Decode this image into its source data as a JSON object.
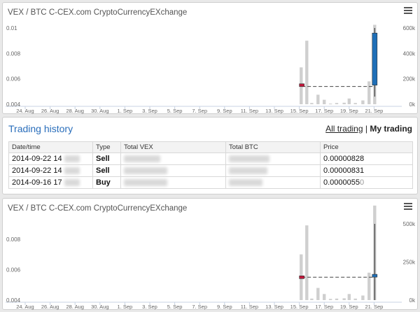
{
  "charts": [
    {
      "title": "VEX / BTC",
      "subtitle": "C-CEX.com CryptoCurrencyEXchange",
      "y_ticks": [
        "0.01",
        "0.008",
        "0.006",
        "0.004"
      ],
      "volume_ticks": [
        "600k",
        "400k",
        "200k",
        "0k"
      ]
    },
    {
      "title": "VEX / BTC",
      "subtitle": "C-CEX.com CryptoCurrencyEXchange",
      "y_ticks": [
        "0.008",
        "0.006",
        "0.004"
      ],
      "volume_ticks": [
        "500k",
        "250k",
        "0k"
      ]
    }
  ],
  "x_ticks": [
    "24. Aug",
    "26. Aug",
    "28. Aug",
    "30. Aug",
    "1. Sep",
    "3. Sep",
    "5. Sep",
    "7. Sep",
    "9. Sep",
    "11. Sep",
    "13. Sep",
    "15. Sep",
    "17. Sep",
    "19. Sep",
    "21. Sep"
  ],
  "history": {
    "title": "Trading history",
    "tab_all": "All trading",
    "tab_separator": "|",
    "tab_my": "My trading",
    "columns": [
      "Date/time",
      "Type",
      "Total VEX",
      "Total BTC",
      "Price"
    ],
    "rows": [
      {
        "datetime": "2014-09-22 14",
        "type": "Sell",
        "price": "0.00000828",
        "price_tail": ""
      },
      {
        "datetime": "2014-09-22 14",
        "type": "Sell",
        "price": "0.00000831",
        "price_tail": ""
      },
      {
        "datetime": "2014-09-16 17",
        "type": "Buy",
        "price": "0.0000055",
        "price_tail": "0"
      }
    ]
  },
  "chart_data": [
    {
      "type": "bar",
      "title": "VEX / BTC",
      "subtitle": "C-CEX.com CryptoCurrencyEXchange",
      "xlabel": "",
      "ylabel": "",
      "x_ticks": [
        "24. Aug",
        "26. Aug",
        "28. Aug",
        "30. Aug",
        "1. Sep",
        "3. Sep",
        "5. Sep",
        "7. Sep",
        "9. Sep",
        "11. Sep",
        "13. Sep",
        "15. Sep",
        "17. Sep",
        "19. Sep",
        "21. Sep"
      ],
      "x_range_days": [
        0,
        30
      ],
      "price_axis": [
        0.004,
        0.01
      ],
      "volume_axis": [
        0,
        600000
      ],
      "grid": false,
      "volume_series": {
        "name": "Volume",
        "x_days": [
          22.15,
          22.6,
          23.0,
          23.5,
          24.0,
          24.5,
          25.0,
          25.6,
          26.0,
          26.5,
          27.1,
          27.6,
          28.05
        ],
        "values": [
          290000,
          500000,
          10000,
          75000,
          35000,
          5000,
          10000,
          12000,
          45000,
          10000,
          30000,
          180000,
          625000
        ]
      },
      "candles": [
        {
          "x_day": 22.2,
          "open": 0.0055,
          "close": 0.0055,
          "high": 0.0055,
          "low": 0.0055,
          "color": "#c0163a"
        },
        {
          "x_day": 28.05,
          "open": 0.0055,
          "close": 0.0096,
          "high": 0.01,
          "low": 0.0046,
          "color": "#1f6fb7"
        }
      ],
      "last_price_line": 0.0054
    },
    {
      "type": "bar",
      "title": "VEX / BTC",
      "subtitle": "C-CEX.com CryptoCurrencyEXchange",
      "xlabel": "",
      "ylabel": "",
      "x_ticks": [
        "24. Aug",
        "26. Aug",
        "28. Aug",
        "30. Aug",
        "1. Sep",
        "3. Sep",
        "5. Sep",
        "7. Sep",
        "9. Sep",
        "11. Sep",
        "13. Sep",
        "15. Sep",
        "17. Sep",
        "19. Sep",
        "21. Sep"
      ],
      "x_range_days": [
        0,
        30
      ],
      "price_axis": [
        0.004,
        0.009
      ],
      "volume_axis": [
        0,
        500000
      ],
      "grid": false,
      "volume_series": {
        "name": "Volume",
        "x_days": [
          22.15,
          22.6,
          23.0,
          23.5,
          24.0,
          24.5,
          25.0,
          25.6,
          26.0,
          26.5,
          27.1,
          27.6,
          28.05
        ],
        "values": [
          300000,
          490000,
          10000,
          80000,
          40000,
          8000,
          10000,
          12000,
          40000,
          10000,
          30000,
          180000,
          620000
        ]
      },
      "candles": [
        {
          "x_day": 22.2,
          "open": 0.0055,
          "close": 0.0055,
          "high": 0.0055,
          "low": 0.0055,
          "color": "#c0163a"
        },
        {
          "x_day": 28.05,
          "open": 0.0056,
          "close": 0.0056,
          "high": 0.009,
          "low": 0.004,
          "color": "#1f6fb7"
        }
      ],
      "last_price_line": 0.0055
    }
  ],
  "colors": {
    "accent": "#2a6ebb",
    "volume_bar": "#cfcfcf",
    "candle_down": "#c0163a",
    "candle_up": "#1f6fb7",
    "axis_text": "#666666"
  }
}
